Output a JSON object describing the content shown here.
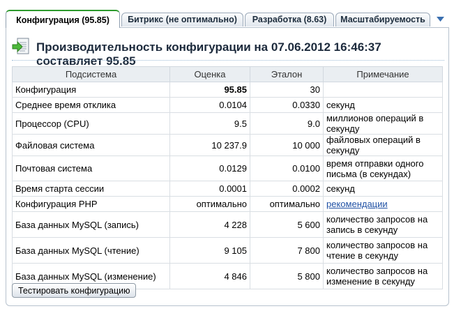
{
  "tabs": [
    {
      "label": "Конфигурация (95.85)",
      "active": true
    },
    {
      "label": "Битрикс (не оптимально)",
      "active": false
    },
    {
      "label": "Разработка (8.63)",
      "active": false
    },
    {
      "label": "Масштабируемость",
      "active": false
    }
  ],
  "header": {
    "icon": "performance-doc-icon",
    "title": "Производительность конфигурации на 07.06.2012 16:46:37 составляет 95.85"
  },
  "table": {
    "columns": [
      "Подсистема",
      "Оценка",
      "Эталон",
      "Примечание"
    ],
    "rows": [
      {
        "subsystem": "Конфигурация",
        "score": "95.85",
        "reference": "30",
        "note": ""
      },
      {
        "subsystem": "Среднее время отклика",
        "score": "0.0104",
        "reference": "0.0330",
        "note": "секунд"
      },
      {
        "subsystem": "Процессор (CPU)",
        "score": "9.5",
        "reference": "9.0",
        "note": "миллионов операций в секунду"
      },
      {
        "subsystem": "Файловая система",
        "score": "10 237.9",
        "reference": "10 000",
        "note": "файловых операций в секунду"
      },
      {
        "subsystem": "Почтовая система",
        "score": "0.0129",
        "reference": "0.0100",
        "note": "время отправки одного письма (в секундах)"
      },
      {
        "subsystem": "Время старта сессии",
        "score": "0.0001",
        "reference": "0.0002",
        "note": "секунд"
      },
      {
        "subsystem": "Конфигурация PHP",
        "score": "оптимально",
        "reference": "оптимально",
        "note": "рекомендации"
      },
      {
        "subsystem": "База данных MySQL (запись)",
        "score": "4 228",
        "reference": "5 600",
        "note": "количество запросов на запись в секунду"
      },
      {
        "subsystem": "База данных MySQL (чтение)",
        "score": "9 105",
        "reference": "7 800",
        "note": "количество запросов на чтение в секунду"
      },
      {
        "subsystem": "База данных MySQL (изменение)",
        "score": "4 846",
        "reference": "5 800",
        "note": "количество запросов на изменение в секунду"
      }
    ]
  },
  "buttons": {
    "test_config": "Тестировать конфигурацию"
  },
  "colors": {
    "active_tab_accent": "#2c9a2c",
    "link": "#2152a5",
    "header_bg": "#eaeef2",
    "title": "#1c2a3c"
  }
}
